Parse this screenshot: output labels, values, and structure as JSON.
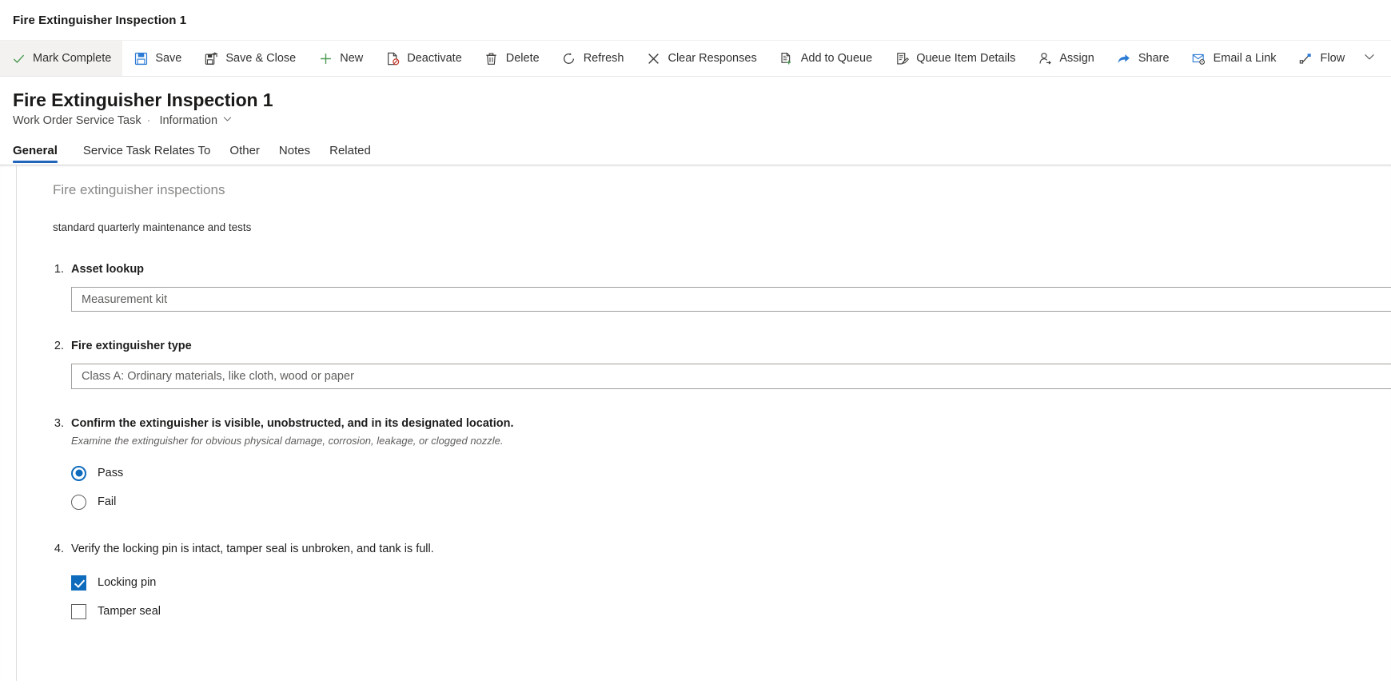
{
  "app": {
    "title": "Fire Extinguisher Inspection 1"
  },
  "commandbar": {
    "items": [
      {
        "label": "Mark Complete",
        "icon": "checkmark-icon",
        "active": true
      },
      {
        "label": "Save",
        "icon": "save-icon",
        "active": false
      },
      {
        "label": "Save & Close",
        "icon": "save-close-icon",
        "active": false
      },
      {
        "label": "New",
        "icon": "plus-icon",
        "active": false
      },
      {
        "label": "Deactivate",
        "icon": "deactivate-icon",
        "active": false
      },
      {
        "label": "Delete",
        "icon": "trash-icon",
        "active": false
      },
      {
        "label": "Refresh",
        "icon": "refresh-icon",
        "active": false
      },
      {
        "label": "Clear Responses",
        "icon": "close-x-icon",
        "active": false
      },
      {
        "label": "Add to Queue",
        "icon": "add-to-queue-icon",
        "active": false
      },
      {
        "label": "Queue Item Details",
        "icon": "queue-item-details-icon",
        "active": false
      },
      {
        "label": "Assign",
        "icon": "assign-person-icon",
        "active": false
      },
      {
        "label": "Share",
        "icon": "share-icon",
        "active": false
      },
      {
        "label": "Email a Link",
        "icon": "email-link-icon",
        "active": false
      },
      {
        "label": "Flow",
        "icon": "flow-icon",
        "active": false
      }
    ],
    "overflow_icon": "chevron-down-icon"
  },
  "record": {
    "title": "Fire Extinguisher Inspection 1",
    "entity": "Work Order Service Task",
    "separator": "·",
    "form_name": "Information",
    "form_chevron": "chevron-down-icon"
  },
  "tabs": [
    {
      "label": "General",
      "selected": true
    },
    {
      "label": "Service Task Relates To",
      "selected": false
    },
    {
      "label": "Other",
      "selected": false
    },
    {
      "label": "Notes",
      "selected": false
    },
    {
      "label": "Related",
      "selected": false
    }
  ],
  "inspection": {
    "section_title": "Fire extinguisher inspections",
    "section_description": "standard quarterly maintenance and tests",
    "questions": [
      {
        "number": "1.",
        "label": "Asset lookup",
        "bold": true,
        "hint": "",
        "type": "text",
        "value": "Measurement kit"
      },
      {
        "number": "2.",
        "label": "Fire extinguisher type",
        "bold": true,
        "hint": "",
        "type": "text",
        "value": "Class A: Ordinary materials, like cloth, wood or paper"
      },
      {
        "number": "3.",
        "label": "Confirm the extinguisher is visible, unobstructed, and in its designated location.",
        "bold": true,
        "hint": "Examine the extinguisher for obvious physical damage, corrosion, leakage, or clogged nozzle.",
        "type": "radio",
        "options": [
          {
            "label": "Pass",
            "checked": true
          },
          {
            "label": "Fail",
            "checked": false
          }
        ]
      },
      {
        "number": "4.",
        "label": "Verify the locking pin is intact, tamper seal is unbroken, and tank is full.",
        "bold": false,
        "hint": "",
        "type": "checkbox",
        "options": [
          {
            "label": "Locking pin",
            "checked": true
          },
          {
            "label": "Tamper seal",
            "checked": false
          }
        ]
      }
    ]
  },
  "colors": {
    "accent": "#2266bb",
    "control_blue": "#0f6cbd",
    "icon_blue": "#2c7bd4",
    "icon_green": "#4c9a52",
    "icon_red": "#c23c2f"
  }
}
